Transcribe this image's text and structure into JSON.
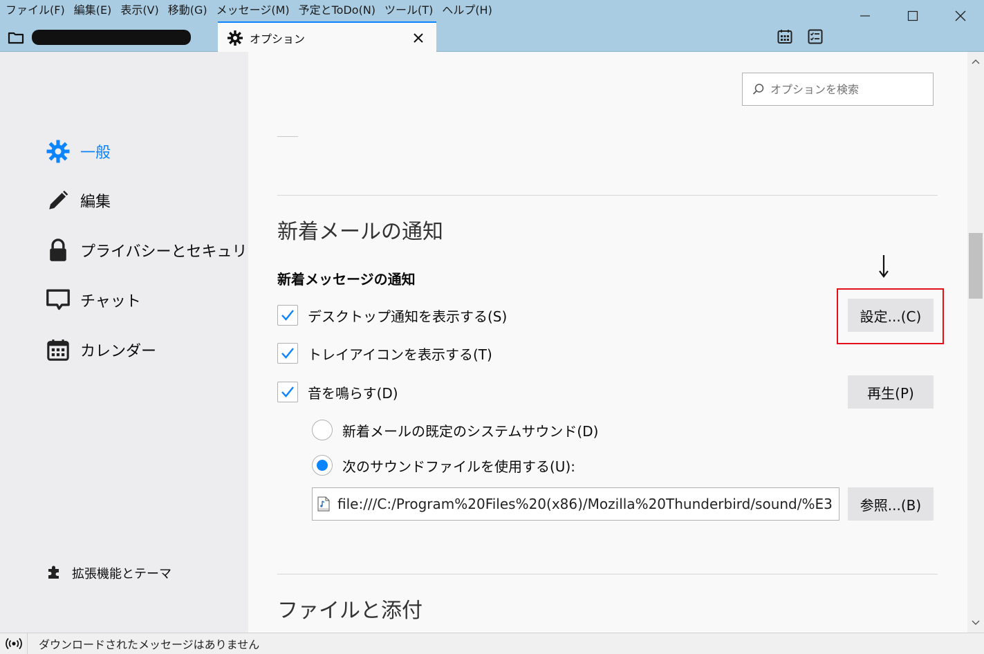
{
  "menubar": {
    "items": [
      "ファイル(F)",
      "編集(E)",
      "表示(V)",
      "移動(G)",
      "メッセージ(M)",
      "予定とToDo(N)",
      "ツール(T)",
      "ヘルプ(H)"
    ]
  },
  "tabs": {
    "options_label": "オプション"
  },
  "sidebar": {
    "items": [
      {
        "label": "一般",
        "icon": "gear-icon"
      },
      {
        "label": "編集",
        "icon": "pencil-icon"
      },
      {
        "label": "プライバシーとセキュリティ",
        "icon": "lock-icon"
      },
      {
        "label": "チャット",
        "icon": "chat-bubble-icon"
      },
      {
        "label": "カレンダー",
        "icon": "calendar-icon"
      }
    ],
    "extensions_label": "拡張機能とテーマ"
  },
  "search": {
    "placeholder": "オプションを検索"
  },
  "new_mail": {
    "section_title": "新着メールの通知",
    "subsection_title": "新着メッセージの通知",
    "desktop_notify_label": "デスクトップ通知を表示する(S)",
    "desktop_notify_checked": true,
    "settings_button": "設定...(C)",
    "tray_icon_label": "トレイアイコンを表示する(T)",
    "tray_icon_checked": true,
    "play_sound_label": "音を鳴らす(D)",
    "play_sound_checked": true,
    "play_button": "再生(P)",
    "default_sound_label": "新着メールの既定のシステムサウンド(D)",
    "custom_sound_label": "次のサウンドファイルを使用する(U):",
    "selected_sound_option": "custom",
    "sound_file_path": "file:///C:/Program%20Files%20(x86)/Mozilla%20Thunderbird/sound/%E3",
    "browse_button": "参照...(B)"
  },
  "files_section": {
    "title": "ファイルと添付"
  },
  "statusbar": {
    "text": "ダウンロードされたメッセージはありません"
  },
  "colors": {
    "accent": "#0a84ff",
    "titlebar": "#a9cce3",
    "highlight_box": "#e3101a"
  }
}
